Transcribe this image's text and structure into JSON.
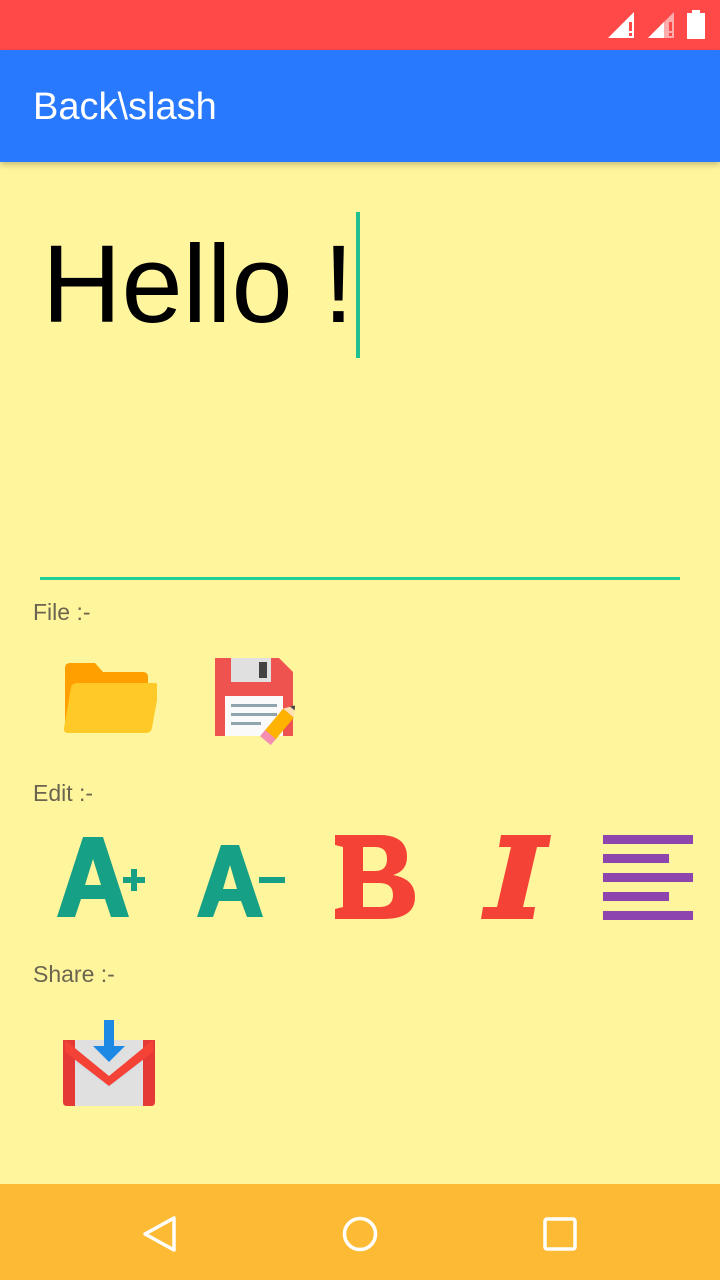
{
  "app": {
    "title": "Back\\slash"
  },
  "editor": {
    "text": "Hello !"
  },
  "sections": {
    "file": {
      "label": "File :-"
    },
    "edit": {
      "label": "Edit :-"
    },
    "share": {
      "label": "Share :-"
    }
  },
  "icons": {
    "file": [
      "open-folder-icon",
      "save-file-icon"
    ],
    "edit": [
      "increase-font-icon",
      "decrease-font-icon",
      "bold-icon",
      "italic-icon",
      "align-icon"
    ],
    "share": [
      "gmail-share-icon"
    ]
  },
  "colors": {
    "status_bar": "#ff4848",
    "app_bar": "#2979ff",
    "background": "#fff59d",
    "accent": "#1fcf96",
    "nav_bar": "#fdba35"
  }
}
